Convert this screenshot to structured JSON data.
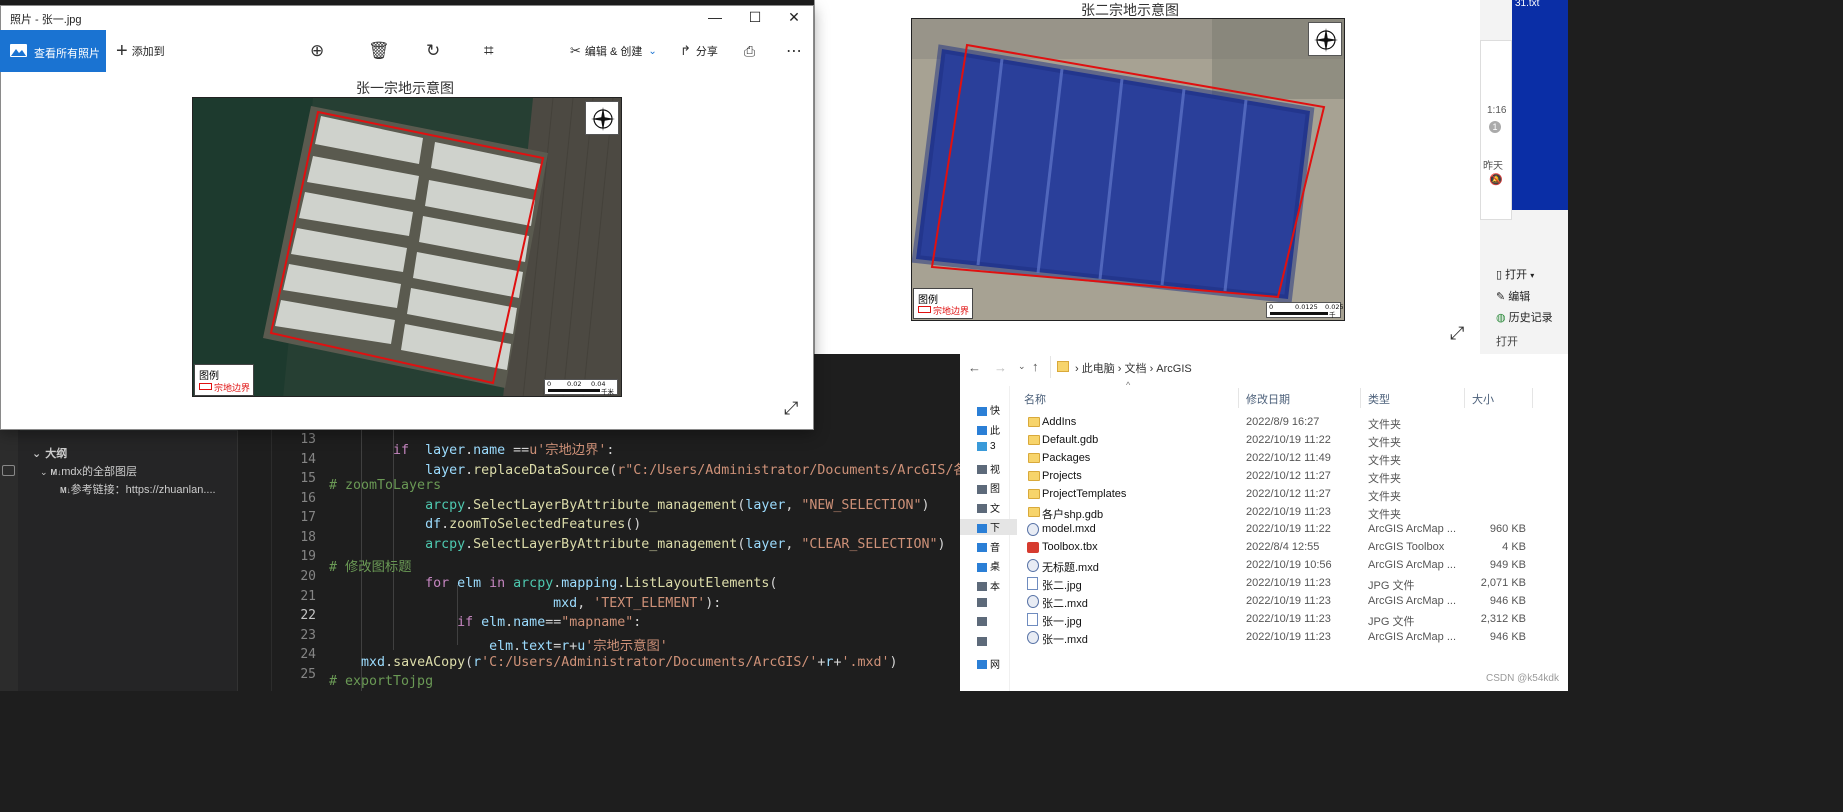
{
  "viewer1": {
    "window_title": "照片 - 张一.jpg",
    "view_all": "查看所有照片",
    "add_to": "添加到",
    "edit_create": "编辑 & 创建",
    "share": "分享",
    "map_title": "张一宗地示意图",
    "legend_title": "图例",
    "legend_item": "宗地边界",
    "scale_labels": [
      "0",
      "0.02",
      "0.04"
    ],
    "scale_unit": "千米",
    "compass_letters": [
      "N",
      "S",
      "W",
      "E"
    ]
  },
  "viewer2": {
    "map_title": "张二宗地示意图",
    "legend_title": "图例",
    "legend_item": "宗地边界",
    "scale_labels": [
      "0",
      "0.0125",
      "0.025"
    ],
    "scale_unit": "千米",
    "compass_letters": [
      "N",
      "S",
      "W",
      "E"
    ]
  },
  "editor": {
    "outline_header": "大纲",
    "outline_items": [
      "mdx的全部图层",
      "参考链接：https://zhuanlan...."
    ],
    "line_numbers": [
      "13",
      "14",
      "15",
      "16",
      "17",
      "18",
      "19",
      "20",
      "21",
      "22",
      "23",
      "24",
      "25"
    ],
    "active_line": "22"
  },
  "explorer": {
    "breadcrumb": [
      "此电脑",
      "文档",
      "ArcGIS"
    ],
    "columns": [
      "名称",
      "修改日期",
      "类型",
      "大小"
    ],
    "nav_items": [
      "快",
      "此",
      "3",
      "视",
      "图",
      "文",
      "下",
      "音",
      "桌",
      "本",
      "",
      "",
      "",
      "网"
    ],
    "ribbon": {
      "open": "打开",
      "edit": "编辑",
      "history": "历史记录",
      "group": "打开"
    },
    "files": [
      {
        "name": "AddIns",
        "date": "2022/8/9 16:27",
        "type": "文件夹",
        "size": "",
        "icon": "folder"
      },
      {
        "name": "Default.gdb",
        "date": "2022/10/19 11:22",
        "type": "文件夹",
        "size": "",
        "icon": "folder"
      },
      {
        "name": "Packages",
        "date": "2022/10/12 11:49",
        "type": "文件夹",
        "size": "",
        "icon": "folder"
      },
      {
        "name": "Projects",
        "date": "2022/10/12 11:27",
        "type": "文件夹",
        "size": "",
        "icon": "folder"
      },
      {
        "name": "ProjectTemplates",
        "date": "2022/10/12 11:27",
        "type": "文件夹",
        "size": "",
        "icon": "folder"
      },
      {
        "name": "各户shp.gdb",
        "date": "2022/10/19 11:23",
        "type": "文件夹",
        "size": "",
        "icon": "folder"
      },
      {
        "name": "model.mxd",
        "date": "2022/10/19 11:22",
        "type": "ArcGIS ArcMap ...",
        "size": "960 KB",
        "icon": "mxd"
      },
      {
        "name": "Toolbox.tbx",
        "date": "2022/8/4 12:55",
        "type": "ArcGIS Toolbox",
        "size": "4 KB",
        "icon": "tbx"
      },
      {
        "name": "无标题.mxd",
        "date": "2022/10/19 10:56",
        "type": "ArcGIS ArcMap ...",
        "size": "949 KB",
        "icon": "mxd"
      },
      {
        "name": "张二.jpg",
        "date": "2022/10/19 11:23",
        "type": "JPG 文件",
        "size": "2,071 KB",
        "icon": "jpg"
      },
      {
        "name": "张二.mxd",
        "date": "2022/10/19 11:23",
        "type": "ArcGIS ArcMap ...",
        "size": "946 KB",
        "icon": "mxd"
      },
      {
        "name": "张一.jpg",
        "date": "2022/10/19 11:23",
        "type": "JPG 文件",
        "size": "2,312 KB",
        "icon": "jpg"
      },
      {
        "name": "张一.mxd",
        "date": "2022/10/19 11:23",
        "type": "ArcGIS ArcMap ...",
        "size": "946 KB",
        "icon": "mxd"
      }
    ]
  },
  "side_panel": {
    "time": "1:16",
    "day": "昨天",
    "file_tail": "31.txt"
  },
  "watermark": "CSDN @k54kdk"
}
